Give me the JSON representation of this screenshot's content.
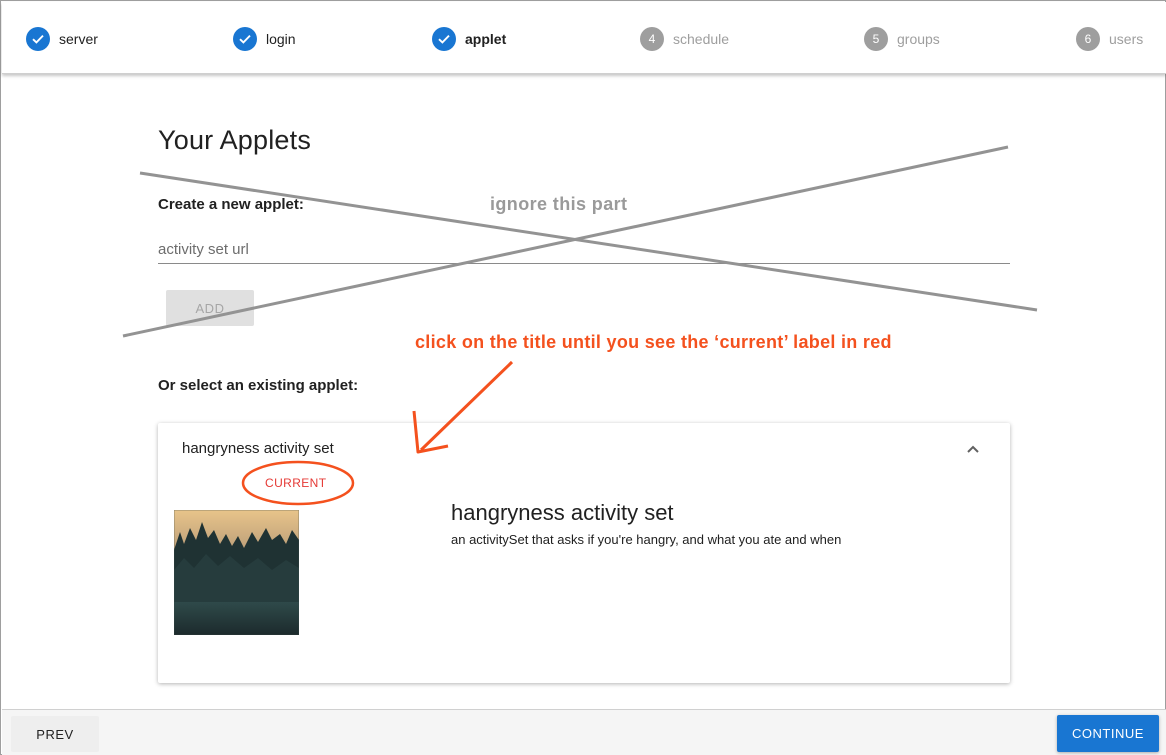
{
  "stepper": {
    "steps": [
      {
        "number": "1",
        "label": "server",
        "state": "done"
      },
      {
        "number": "2",
        "label": "login",
        "state": "done"
      },
      {
        "number": "3",
        "label": "applet",
        "state": "active"
      },
      {
        "number": "4",
        "label": "schedule",
        "state": "todo"
      },
      {
        "number": "5",
        "label": "groups",
        "state": "todo"
      },
      {
        "number": "6",
        "label": "users",
        "state": "todo"
      }
    ]
  },
  "page": {
    "title": "Your Applets",
    "create_label": "Create a new applet:",
    "url_placeholder": "activity set url",
    "add_label": "ADD",
    "select_label": "Or select an existing applet:"
  },
  "applet_card": {
    "title": "hangryness activity set",
    "current_label": "CURRENT",
    "name": "hangryness activity set",
    "description": "an activitySet that asks if you're hangry, and what you ate and when"
  },
  "footer": {
    "prev_label": "PREV",
    "continue_label": "CONTINUE"
  },
  "annotations": {
    "ignore_note": "ignore this part",
    "click_note": "click on the title until you see the ‘current’ label in  red"
  },
  "colors": {
    "primary": "#1976d2",
    "current_red": "#e53935",
    "annotation_red": "#f4511e",
    "annotation_gray": "#9a9a9a",
    "step_inactive": "#9e9e9e"
  }
}
